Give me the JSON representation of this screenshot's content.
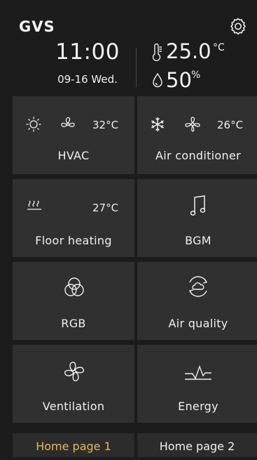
{
  "header": {
    "logo": "GVS",
    "time": "11:00",
    "date": "09-16  Wed.",
    "temperature": "25.0",
    "temperature_unit": "°C",
    "humidity": "50",
    "humidity_unit": "%"
  },
  "tiles": {
    "hvac": {
      "label": "HVAC",
      "temp": "32°C",
      "icons": [
        "sun-icon",
        "fan-icon"
      ]
    },
    "air_conditioner": {
      "label": "Air conditioner",
      "temp": "26°C",
      "icons": [
        "snowflake-icon",
        "fan-icon"
      ]
    },
    "floor_heating": {
      "label": "Floor heating",
      "temp": "27°C",
      "icons": [
        "heat-waves-icon"
      ]
    },
    "bgm": {
      "label": "BGM",
      "icons": [
        "music-note-icon"
      ]
    },
    "rgb": {
      "label": "RGB",
      "icons": [
        "rgb-circles-icon"
      ]
    },
    "air_quality": {
      "label": "Air quality",
      "icons": [
        "air-quality-icon"
      ]
    },
    "ventilation": {
      "label": "Ventilation",
      "icons": [
        "ventilation-fan-icon"
      ]
    },
    "energy": {
      "label": "Energy",
      "icons": [
        "energy-pulse-icon"
      ]
    }
  },
  "footer": {
    "tabs": [
      {
        "label": "Home page 1",
        "active": true
      },
      {
        "label": "Home page 2",
        "active": false
      }
    ]
  },
  "colors": {
    "background": "#1c1c1c",
    "tile": "#303030",
    "active_tab_text": "#e8b75a",
    "text": "#f0f0f0"
  }
}
